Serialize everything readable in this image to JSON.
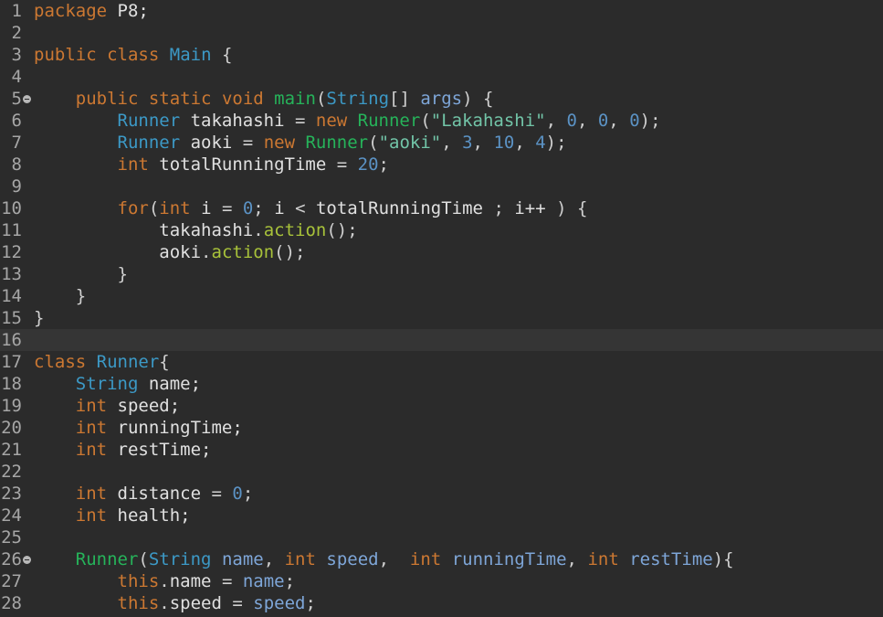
{
  "editor": {
    "theme_colors": {
      "background": "#2b2b2b",
      "current_line": "#353535",
      "keyword": "#cc7832",
      "type": "#3c99c6",
      "method_decl": "#26b35a",
      "identifier": "#e0e0e0",
      "string": "#72c5a8",
      "number": "#5b92c4",
      "parameter": "#7ea6d8",
      "method_call": "#a8c23a"
    },
    "lines": [
      {
        "num": "1",
        "fold": false,
        "current": false,
        "tokens": [
          {
            "t": "package",
            "c": "kw"
          },
          {
            "t": " P8;",
            "c": "id"
          }
        ]
      },
      {
        "num": "2",
        "fold": false,
        "current": false,
        "tokens": []
      },
      {
        "num": "3",
        "fold": false,
        "current": false,
        "tokens": [
          {
            "t": "public",
            "c": "kw"
          },
          {
            "t": " ",
            "c": "id"
          },
          {
            "t": "class",
            "c": "kw"
          },
          {
            "t": " ",
            "c": "id"
          },
          {
            "t": "Main",
            "c": "ty"
          },
          {
            "t": " {",
            "c": "pn"
          }
        ]
      },
      {
        "num": "4",
        "fold": false,
        "current": false,
        "tokens": []
      },
      {
        "num": "5",
        "fold": true,
        "current": false,
        "tokens": [
          {
            "t": "    ",
            "c": "id"
          },
          {
            "t": "public",
            "c": "kw"
          },
          {
            "t": " ",
            "c": "id"
          },
          {
            "t": "static",
            "c": "kw"
          },
          {
            "t": " ",
            "c": "id"
          },
          {
            "t": "void",
            "c": "kw"
          },
          {
            "t": " ",
            "c": "id"
          },
          {
            "t": "main",
            "c": "fn"
          },
          {
            "t": "(",
            "c": "pn"
          },
          {
            "t": "String",
            "c": "ty"
          },
          {
            "t": "[] ",
            "c": "pn"
          },
          {
            "t": "args",
            "c": "pr"
          },
          {
            "t": ") {",
            "c": "pn"
          }
        ]
      },
      {
        "num": "6",
        "fold": false,
        "current": false,
        "tokens": [
          {
            "t": "        ",
            "c": "id"
          },
          {
            "t": "Runner",
            "c": "ty"
          },
          {
            "t": " takahashi ",
            "c": "id"
          },
          {
            "t": "= ",
            "c": "pn"
          },
          {
            "t": "new",
            "c": "kw"
          },
          {
            "t": " ",
            "c": "id"
          },
          {
            "t": "Runner",
            "c": "fn"
          },
          {
            "t": "(",
            "c": "pn"
          },
          {
            "t": "\"Lakahashi\"",
            "c": "st"
          },
          {
            "t": ", ",
            "c": "pn"
          },
          {
            "t": "0",
            "c": "nm"
          },
          {
            "t": ", ",
            "c": "pn"
          },
          {
            "t": "0",
            "c": "nm"
          },
          {
            "t": ", ",
            "c": "pn"
          },
          {
            "t": "0",
            "c": "nm"
          },
          {
            "t": ");",
            "c": "pn"
          }
        ]
      },
      {
        "num": "7",
        "fold": false,
        "current": false,
        "tokens": [
          {
            "t": "        ",
            "c": "id"
          },
          {
            "t": "Runner",
            "c": "ty"
          },
          {
            "t": " aoki ",
            "c": "id"
          },
          {
            "t": "= ",
            "c": "pn"
          },
          {
            "t": "new",
            "c": "kw"
          },
          {
            "t": " ",
            "c": "id"
          },
          {
            "t": "Runner",
            "c": "fn"
          },
          {
            "t": "(",
            "c": "pn"
          },
          {
            "t": "\"aoki\"",
            "c": "st"
          },
          {
            "t": ", ",
            "c": "pn"
          },
          {
            "t": "3",
            "c": "nm"
          },
          {
            "t": ", ",
            "c": "pn"
          },
          {
            "t": "10",
            "c": "nm"
          },
          {
            "t": ", ",
            "c": "pn"
          },
          {
            "t": "4",
            "c": "nm"
          },
          {
            "t": ");",
            "c": "pn"
          }
        ]
      },
      {
        "num": "8",
        "fold": false,
        "current": false,
        "tokens": [
          {
            "t": "        ",
            "c": "id"
          },
          {
            "t": "int",
            "c": "kw"
          },
          {
            "t": " totalRunningTime ",
            "c": "id"
          },
          {
            "t": "= ",
            "c": "pn"
          },
          {
            "t": "20",
            "c": "nm"
          },
          {
            "t": ";",
            "c": "pn"
          }
        ]
      },
      {
        "num": "9",
        "fold": false,
        "current": false,
        "tokens": []
      },
      {
        "num": "10",
        "fold": false,
        "current": false,
        "tokens": [
          {
            "t": "        ",
            "c": "id"
          },
          {
            "t": "for",
            "c": "kw"
          },
          {
            "t": "(",
            "c": "pn"
          },
          {
            "t": "int",
            "c": "kw"
          },
          {
            "t": " i ",
            "c": "id"
          },
          {
            "t": "= ",
            "c": "pn"
          },
          {
            "t": "0",
            "c": "nm"
          },
          {
            "t": "; ",
            "c": "pn"
          },
          {
            "t": "i ",
            "c": "id"
          },
          {
            "t": "< ",
            "c": "pn"
          },
          {
            "t": "totalRunningTime ",
            "c": "id"
          },
          {
            "t": "; ",
            "c": "pn"
          },
          {
            "t": "i++ ",
            "c": "id"
          },
          {
            "t": ") {",
            "c": "pn"
          }
        ]
      },
      {
        "num": "11",
        "fold": false,
        "current": false,
        "tokens": [
          {
            "t": "            ",
            "c": "id"
          },
          {
            "t": "takahashi",
            "c": "id"
          },
          {
            "t": ".",
            "c": "pn"
          },
          {
            "t": "action",
            "c": "mt"
          },
          {
            "t": "();",
            "c": "pn"
          }
        ]
      },
      {
        "num": "12",
        "fold": false,
        "current": false,
        "tokens": [
          {
            "t": "            ",
            "c": "id"
          },
          {
            "t": "aoki",
            "c": "id"
          },
          {
            "t": ".",
            "c": "pn"
          },
          {
            "t": "action",
            "c": "mt"
          },
          {
            "t": "();",
            "c": "pn"
          }
        ]
      },
      {
        "num": "13",
        "fold": false,
        "current": false,
        "tokens": [
          {
            "t": "        }",
            "c": "pn"
          }
        ]
      },
      {
        "num": "14",
        "fold": false,
        "current": false,
        "tokens": [
          {
            "t": "    }",
            "c": "pn"
          }
        ]
      },
      {
        "num": "15",
        "fold": false,
        "current": false,
        "tokens": [
          {
            "t": "}",
            "c": "pn"
          }
        ]
      },
      {
        "num": "16",
        "fold": false,
        "current": true,
        "tokens": []
      },
      {
        "num": "17",
        "fold": false,
        "current": false,
        "tokens": [
          {
            "t": "class",
            "c": "kw"
          },
          {
            "t": " ",
            "c": "id"
          },
          {
            "t": "Runner",
            "c": "ty"
          },
          {
            "t": "{",
            "c": "pn"
          }
        ]
      },
      {
        "num": "18",
        "fold": false,
        "current": false,
        "tokens": [
          {
            "t": "    ",
            "c": "id"
          },
          {
            "t": "String",
            "c": "ty"
          },
          {
            "t": " name;",
            "c": "id"
          }
        ]
      },
      {
        "num": "19",
        "fold": false,
        "current": false,
        "tokens": [
          {
            "t": "    ",
            "c": "id"
          },
          {
            "t": "int",
            "c": "kw"
          },
          {
            "t": " speed;",
            "c": "id"
          }
        ]
      },
      {
        "num": "20",
        "fold": false,
        "current": false,
        "tokens": [
          {
            "t": "    ",
            "c": "id"
          },
          {
            "t": "int",
            "c": "kw"
          },
          {
            "t": " runningTime;",
            "c": "id"
          }
        ]
      },
      {
        "num": "21",
        "fold": false,
        "current": false,
        "tokens": [
          {
            "t": "    ",
            "c": "id"
          },
          {
            "t": "int",
            "c": "kw"
          },
          {
            "t": " restTime;",
            "c": "id"
          }
        ]
      },
      {
        "num": "22",
        "fold": false,
        "current": false,
        "tokens": []
      },
      {
        "num": "23",
        "fold": false,
        "current": false,
        "tokens": [
          {
            "t": "    ",
            "c": "id"
          },
          {
            "t": "int",
            "c": "kw"
          },
          {
            "t": " distance ",
            "c": "id"
          },
          {
            "t": "= ",
            "c": "pn"
          },
          {
            "t": "0",
            "c": "nm"
          },
          {
            "t": ";",
            "c": "pn"
          }
        ]
      },
      {
        "num": "24",
        "fold": false,
        "current": false,
        "tokens": [
          {
            "t": "    ",
            "c": "id"
          },
          {
            "t": "int",
            "c": "kw"
          },
          {
            "t": " health;",
            "c": "id"
          }
        ]
      },
      {
        "num": "25",
        "fold": false,
        "current": false,
        "tokens": []
      },
      {
        "num": "26",
        "fold": true,
        "current": false,
        "tokens": [
          {
            "t": "    ",
            "c": "id"
          },
          {
            "t": "Runner",
            "c": "fn"
          },
          {
            "t": "(",
            "c": "pn"
          },
          {
            "t": "String",
            "c": "ty"
          },
          {
            "t": " ",
            "c": "id"
          },
          {
            "t": "name",
            "c": "pr"
          },
          {
            "t": ", ",
            "c": "pn"
          },
          {
            "t": "int",
            "c": "kw"
          },
          {
            "t": " ",
            "c": "id"
          },
          {
            "t": "speed",
            "c": "pr"
          },
          {
            "t": ",  ",
            "c": "pn"
          },
          {
            "t": "int",
            "c": "kw"
          },
          {
            "t": " ",
            "c": "id"
          },
          {
            "t": "runningTime",
            "c": "pr"
          },
          {
            "t": ", ",
            "c": "pn"
          },
          {
            "t": "int",
            "c": "kw"
          },
          {
            "t": " ",
            "c": "id"
          },
          {
            "t": "restTime",
            "c": "pr"
          },
          {
            "t": "){",
            "c": "pn"
          }
        ]
      },
      {
        "num": "27",
        "fold": false,
        "current": false,
        "tokens": [
          {
            "t": "        ",
            "c": "id"
          },
          {
            "t": "this",
            "c": "kw"
          },
          {
            "t": ".",
            "c": "pn"
          },
          {
            "t": "name ",
            "c": "id"
          },
          {
            "t": "= ",
            "c": "pn"
          },
          {
            "t": "name",
            "c": "pr"
          },
          {
            "t": ";",
            "c": "pn"
          }
        ]
      },
      {
        "num": "28",
        "fold": false,
        "current": false,
        "tokens": [
          {
            "t": "        ",
            "c": "id"
          },
          {
            "t": "this",
            "c": "kw"
          },
          {
            "t": ".",
            "c": "pn"
          },
          {
            "t": "speed ",
            "c": "id"
          },
          {
            "t": "= ",
            "c": "pn"
          },
          {
            "t": "speed",
            "c": "pr"
          },
          {
            "t": ";",
            "c": "pn"
          }
        ]
      }
    ]
  }
}
